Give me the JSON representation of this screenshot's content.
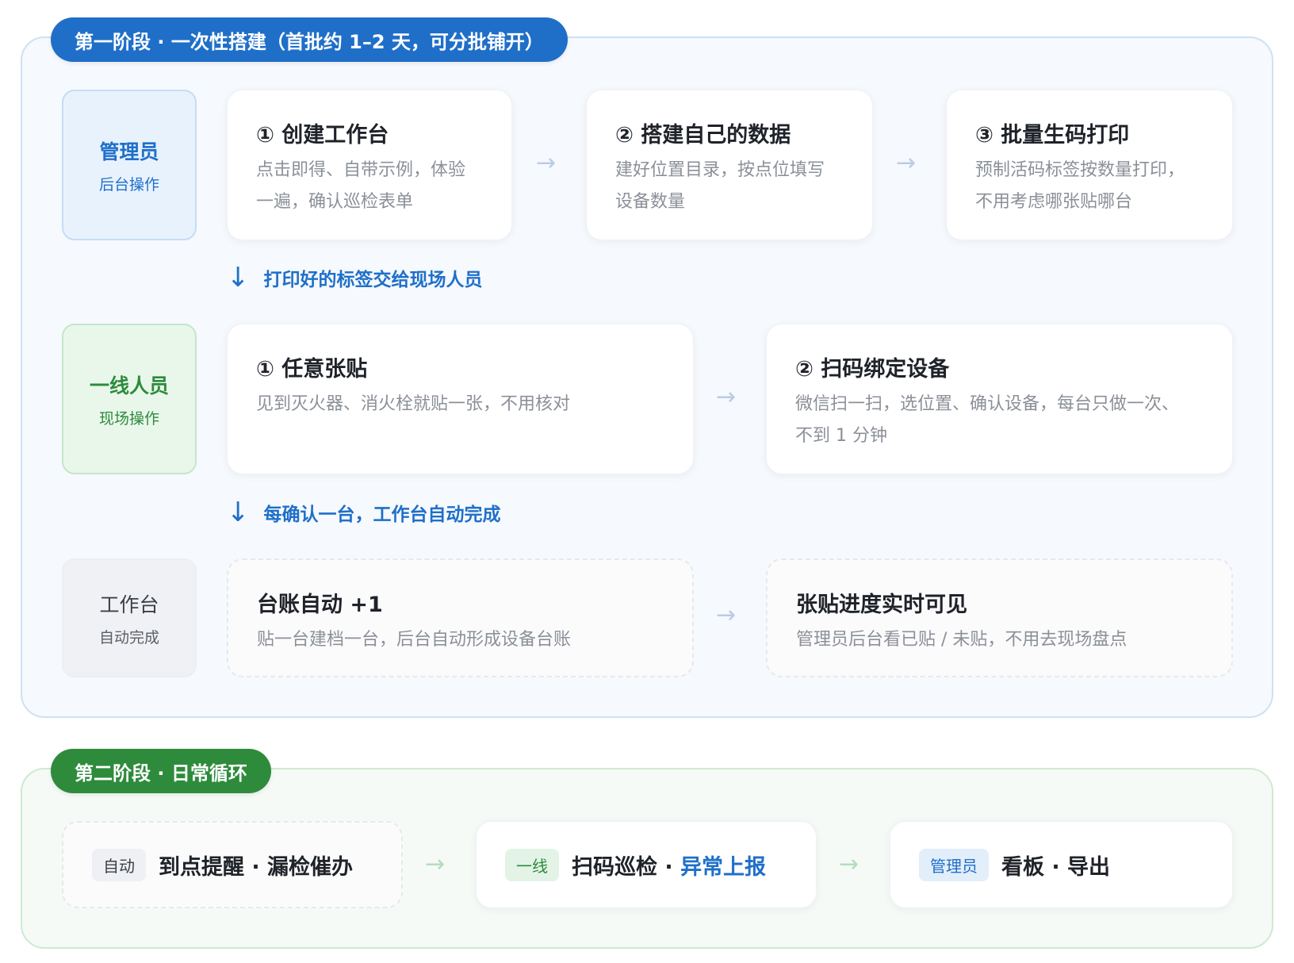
{
  "phase1": {
    "title": "第一阶段 · 一次性搭建（首批约 1–2 天，可分批铺开）",
    "roles": {
      "admin": {
        "title": "管理员",
        "sub": "后台操作"
      },
      "frontline": {
        "title": "一线人员",
        "sub": "现场操作"
      },
      "workbench": {
        "title": "工作台",
        "sub": "自动完成"
      }
    },
    "admin_steps": [
      {
        "title": "① 创建工作台",
        "desc": "点击即得、自带示例，体验一遍，确认巡检表单"
      },
      {
        "title": "② 搭建自己的数据",
        "desc": "建好位置目录，按点位填写设备数量"
      },
      {
        "title": "③ 批量生码打印",
        "desc": "预制活码标签按数量打印，不用考虑哪张贴哪台"
      }
    ],
    "handoff_1": "打印好的标签交给现场人员",
    "frontline_steps": [
      {
        "title": "① 任意张贴",
        "desc": "见到灭火器、消火栓就贴一张，不用核对"
      },
      {
        "title": "② 扫码绑定设备",
        "desc": "微信扫一扫，选位置、确认设备，每台只做一次、不到 1 分钟"
      }
    ],
    "handoff_2": "每确认一台，工作台自动完成",
    "workbench_steps": [
      {
        "title": "台账自动 +1",
        "desc": "贴一台建档一台，后台自动形成设备台账"
      },
      {
        "title": "张贴进度实时可见",
        "desc": "管理员后台看已贴 / 未贴，不用去现场盘点"
      }
    ],
    "arrow_glyph": "→",
    "down_glyph": "↓"
  },
  "phase2": {
    "title": "第二阶段 · 日常循环",
    "items": [
      {
        "tag": "自动",
        "text": "到点提醒 · 漏检催办"
      },
      {
        "tag": "一线",
        "text": "扫码巡检 · ",
        "highlight": "异常上报"
      },
      {
        "tag": "管理员",
        "text": "看板 · 导出"
      }
    ]
  },
  "colors": {
    "phase1_accent": "#1f6fc9",
    "phase2_accent": "#2e8b3c",
    "muted_text": "#8b9098"
  }
}
